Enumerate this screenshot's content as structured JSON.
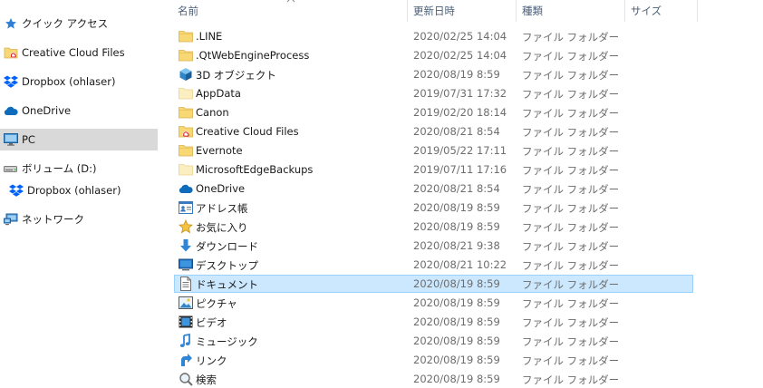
{
  "nav": {
    "quick_access": "クイック アクセス",
    "creative_cloud": "Creative Cloud Files",
    "dropbox": "Dropbox (ohlaser)",
    "onedrive": "OneDrive",
    "pc": "PC",
    "volume_d": "ボリューム (D:)",
    "dropbox_sub": "Dropbox (ohlaser)",
    "network": "ネットワーク"
  },
  "columns": {
    "name": "名前",
    "modified": "更新日時",
    "type": "種類",
    "size": "サイズ"
  },
  "files": [
    {
      "name": ".LINE",
      "modified": "2020/02/25 14:04",
      "type": "ファイル フォルダー",
      "size": "",
      "icon": "folder-icon"
    },
    {
      "name": ".QtWebEngineProcess",
      "modified": "2020/02/25 14:04",
      "type": "ファイル フォルダー",
      "size": "",
      "icon": "folder-icon"
    },
    {
      "name": "3D オブジェクト",
      "modified": "2020/08/19 8:59",
      "type": "ファイル フォルダー",
      "size": "",
      "icon": "3d-objects-icon"
    },
    {
      "name": "AppData",
      "modified": "2019/07/31 17:32",
      "type": "ファイル フォルダー",
      "size": "",
      "icon": "hidden-folder-icon"
    },
    {
      "name": "Canon",
      "modified": "2019/02/20 18:14",
      "type": "ファイル フォルダー",
      "size": "",
      "icon": "folder-icon"
    },
    {
      "name": "Creative Cloud Files",
      "modified": "2020/08/21 8:54",
      "type": "ファイル フォルダー",
      "size": "",
      "icon": "creative-cloud-folder-icon"
    },
    {
      "name": "Evernote",
      "modified": "2019/05/22 17:11",
      "type": "ファイル フォルダー",
      "size": "",
      "icon": "folder-icon"
    },
    {
      "name": "MicrosoftEdgeBackups",
      "modified": "2019/07/11 17:16",
      "type": "ファイル フォルダー",
      "size": "",
      "icon": "hidden-folder-icon"
    },
    {
      "name": "OneDrive",
      "modified": "2020/08/21 8:54",
      "type": "ファイル フォルダー",
      "size": "",
      "icon": "onedrive-icon"
    },
    {
      "name": "アドレス帳",
      "modified": "2020/08/19 8:59",
      "type": "ファイル フォルダー",
      "size": "",
      "icon": "contacts-icon"
    },
    {
      "name": "お気に入り",
      "modified": "2020/08/19 8:59",
      "type": "ファイル フォルダー",
      "size": "",
      "icon": "favorites-star-icon"
    },
    {
      "name": "ダウンロード",
      "modified": "2020/08/21 9:38",
      "type": "ファイル フォルダー",
      "size": "",
      "icon": "downloads-arrow-icon"
    },
    {
      "name": "デスクトップ",
      "modified": "2020/08/21 10:22",
      "type": "ファイル フォルダー",
      "size": "",
      "icon": "desktop-icon"
    },
    {
      "name": "ドキュメント",
      "modified": "2020/08/19 8:59",
      "type": "ファイル フォルダー",
      "size": "",
      "icon": "documents-icon"
    },
    {
      "name": "ピクチャ",
      "modified": "2020/08/19 8:59",
      "type": "ファイル フォルダー",
      "size": "",
      "icon": "pictures-icon"
    },
    {
      "name": "ビデオ",
      "modified": "2020/08/19 8:59",
      "type": "ファイル フォルダー",
      "size": "",
      "icon": "videos-icon"
    },
    {
      "name": "ミュージック",
      "modified": "2020/08/19 8:59",
      "type": "ファイル フォルダー",
      "size": "",
      "icon": "music-icon"
    },
    {
      "name": "リンク",
      "modified": "2020/08/19 8:59",
      "type": "ファイル フォルダー",
      "size": "",
      "icon": "links-icon"
    },
    {
      "name": "検索",
      "modified": "2020/08/19 8:59",
      "type": "ファイル フォルダー",
      "size": "",
      "icon": "searches-icon"
    }
  ],
  "selected_file": "ドキュメント"
}
